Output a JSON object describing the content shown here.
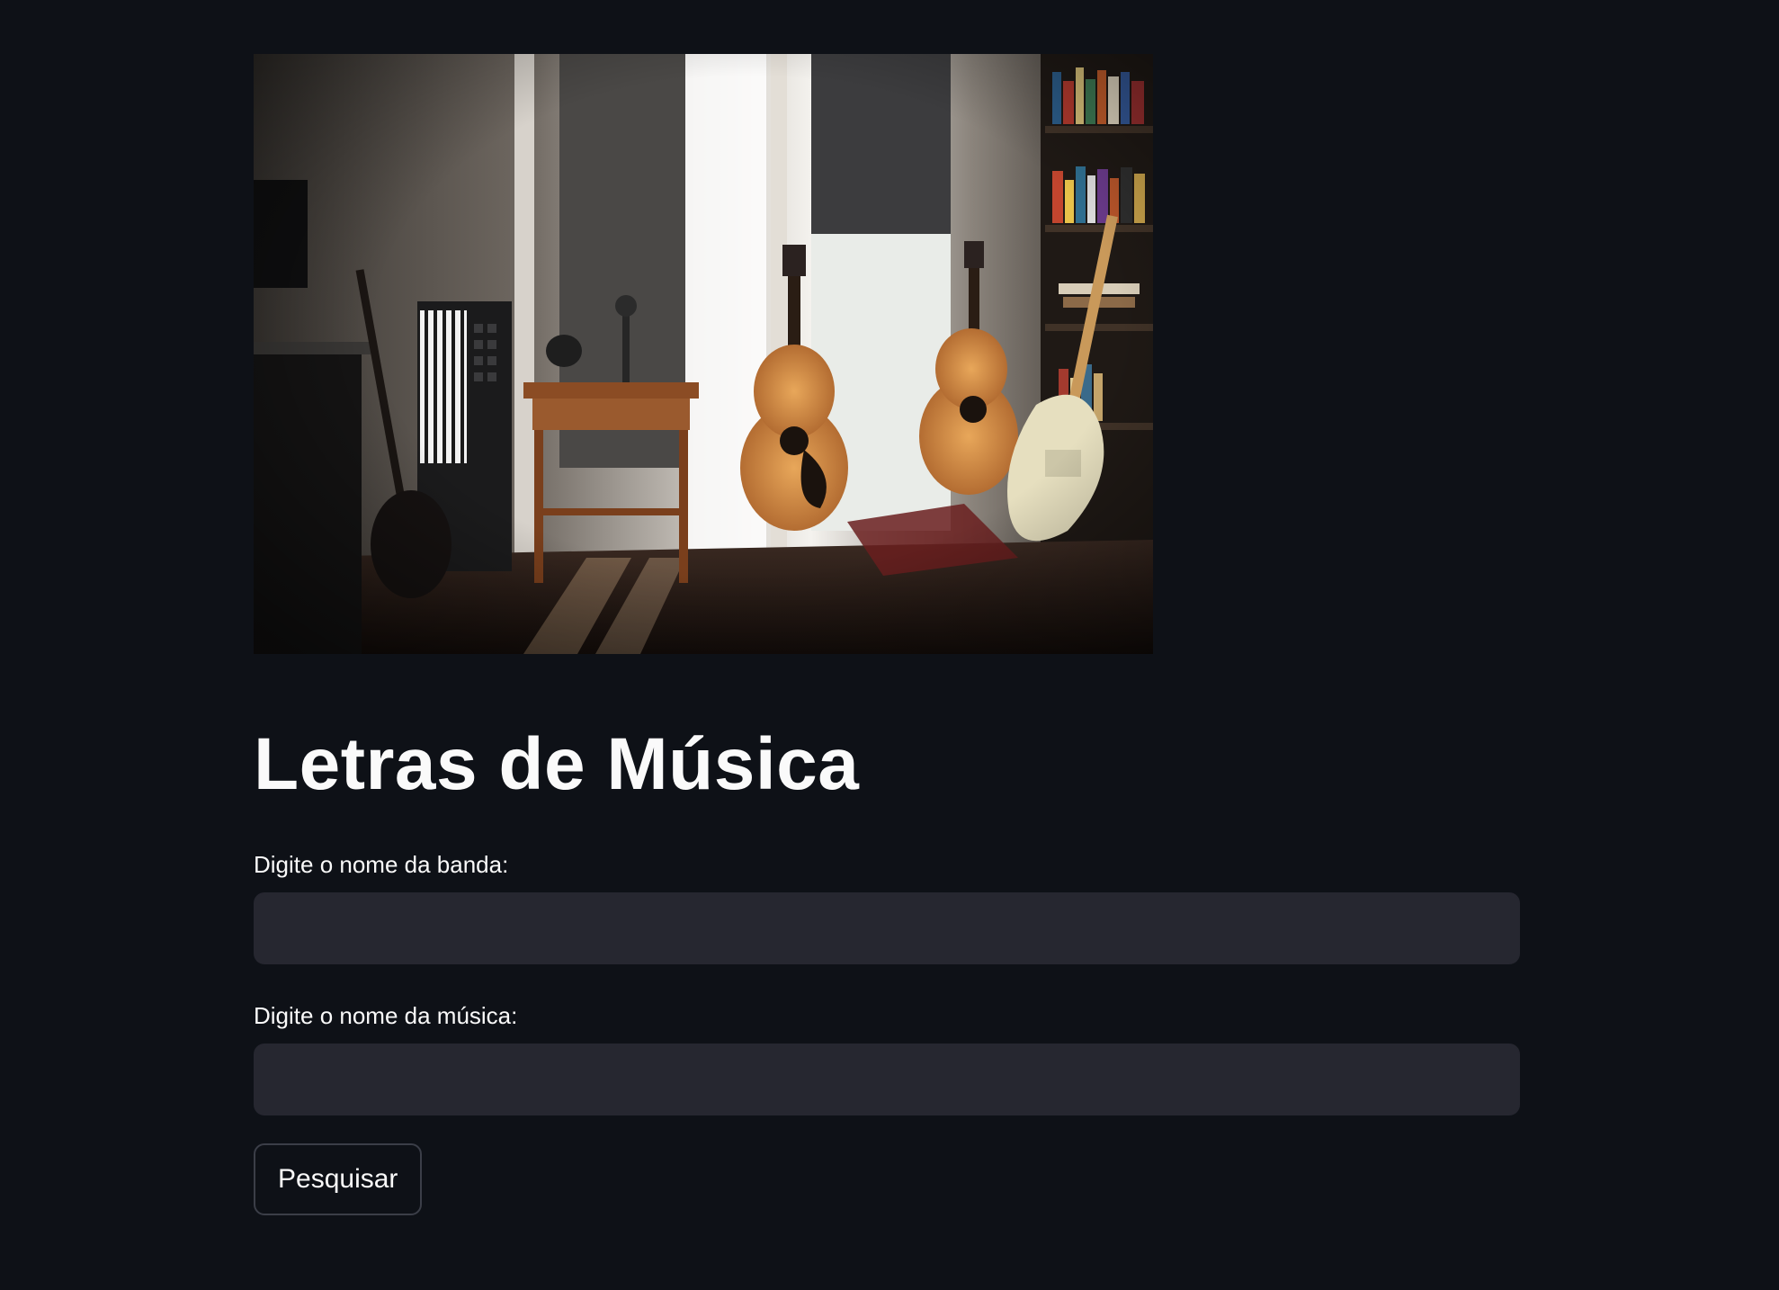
{
  "header_image": {
    "alt": "Guitars and keyboard in a sunlit music room"
  },
  "title": "Letras de Música",
  "form": {
    "band": {
      "label": "Digite o nome da banda:",
      "value": "",
      "placeholder": ""
    },
    "song": {
      "label": "Digite o nome da música:",
      "value": "",
      "placeholder": ""
    },
    "submit_label": "Pesquisar"
  },
  "colors": {
    "background": "#0e1117",
    "input_background": "#262730",
    "text": "#fafafa",
    "button_border": "#3b3e48"
  }
}
